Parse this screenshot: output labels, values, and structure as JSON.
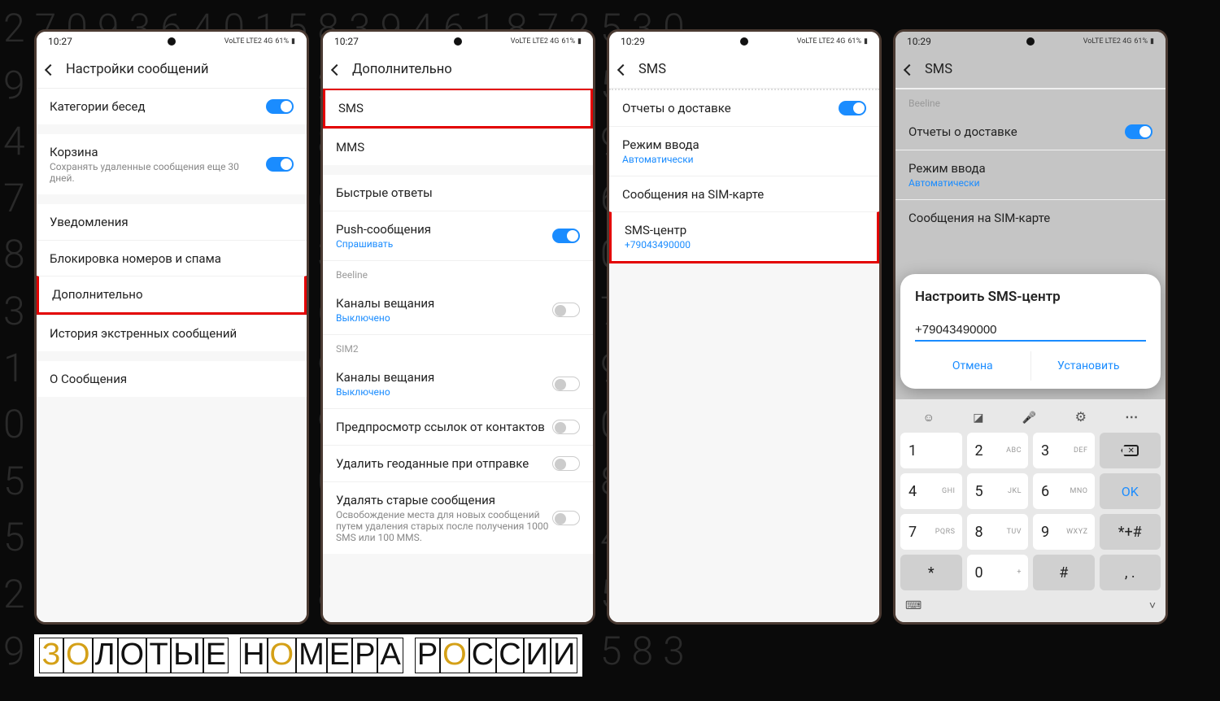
{
  "bg_pattern": "2709364015839461872530",
  "status": {
    "time1": "10:27",
    "time2": "10:27",
    "time3": "10:29",
    "time4": "10:29",
    "battery": "61%",
    "net": "VoLTE LTE2 4G"
  },
  "screen1": {
    "title": "Настройки сообщений",
    "rows": {
      "categories": "Категории бесед",
      "trash": "Корзина",
      "trash_sub": "Сохранять удаленные сообщения еще 30 дней.",
      "notif": "Уведомления",
      "block": "Блокировка номеров и спама",
      "more": "Дополнительно",
      "emergency": "История экстренных сообщений",
      "about": "О Сообщения"
    }
  },
  "screen2": {
    "title": "Дополнительно",
    "rows": {
      "sms": "SMS",
      "mms": "MMS",
      "quick": "Быстрые ответы",
      "push": "Push-сообщения",
      "push_sub": "Спрашивать",
      "sim1": "Beeline",
      "bc1": "Каналы вещания",
      "bc1_sub": "Выключено",
      "sim2": "SIM2",
      "bc2": "Каналы вещания",
      "bc2_sub": "Выключено",
      "preview": "Предпросмотр ссылок от контактов",
      "geo": "Удалить геоданные при отправке",
      "delete": "Удалять старые сообщения",
      "delete_sub": "Освобождение места для новых сообщений путем удаления старых после получения 1000 SMS или 100 MMS."
    }
  },
  "screen3": {
    "title": "SMS",
    "rows": {
      "delivery": "Отчеты о доставке",
      "input": "Режим ввода",
      "input_sub": "Автоматически",
      "sim": "Сообщения на SIM-карте",
      "smsc": "SMS-центр",
      "smsc_sub": "+79043490000"
    }
  },
  "screen4": {
    "title": "SMS",
    "sim_label": "Beeline",
    "rows": {
      "delivery": "Отчеты о доставке",
      "input": "Режим ввода",
      "input_sub": "Автоматически",
      "sim": "Сообщения на SIM-карте"
    },
    "dialog": {
      "title": "Настроить SMS-центр",
      "value": "+79043490000",
      "cancel": "Отмена",
      "ok": "Установить"
    },
    "keys": {
      "k1": "1",
      "k2": "2",
      "k2s": "ABC",
      "k3": "3",
      "k3s": "DEF",
      "k4": "4",
      "k4s": "GHI",
      "k5": "5",
      "k5s": "JKL",
      "k6": "6",
      "k6s": "MNO",
      "kok": "OK",
      "k7": "7",
      "k7s": "PQRS",
      "k8": "8",
      "k8s": "TUV",
      "k9": "9",
      "k9s": "WXYZ",
      "ksym": "*+#",
      "kstar": "*",
      "k0": "0",
      "k0s": "+",
      "khash": "#",
      "kdot": ",  ."
    }
  },
  "brand": "ЗОЛОТЫЕ НОМЕРА РОССИИ"
}
